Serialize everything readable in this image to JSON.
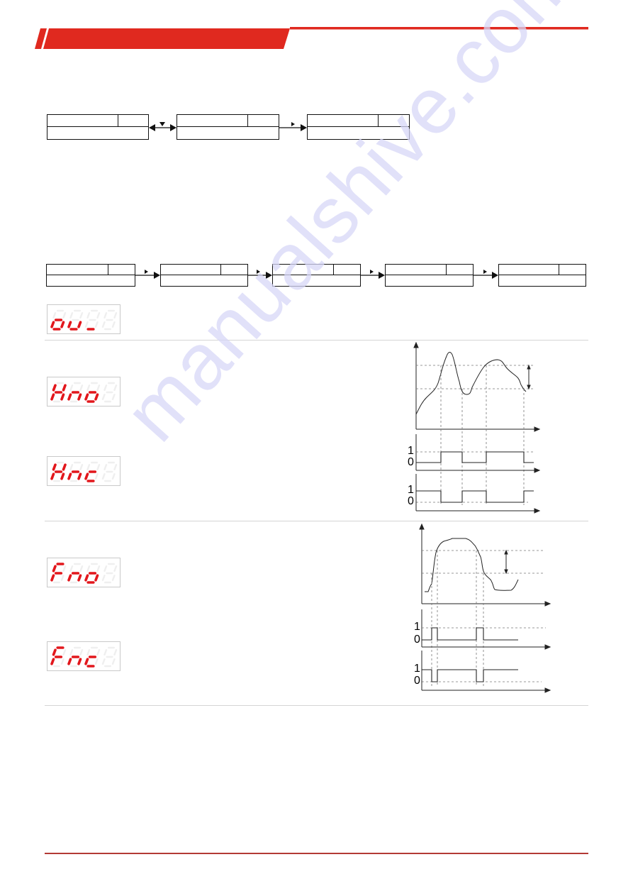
{
  "header": {
    "accent_color": "#e0291f"
  },
  "flow_row_1": {
    "boxes": [
      {
        "label": "",
        "value": "",
        "sub": ""
      },
      {
        "label": "",
        "value": "",
        "sub": ""
      },
      {
        "label": "",
        "value": "",
        "sub": ""
      }
    ],
    "connectors": [
      "bidirectional-down-arrow",
      "right-arrow"
    ]
  },
  "flow_row_2": {
    "boxes": [
      {
        "label": "",
        "value": "",
        "sub": ""
      },
      {
        "label": "",
        "value": "",
        "sub": ""
      },
      {
        "label": "",
        "value": "",
        "sub": ""
      },
      {
        "label": "",
        "value": "",
        "sub": ""
      },
      {
        "label": "",
        "value": "",
        "sub": ""
      }
    ],
    "connectors": [
      "right-arrow",
      "right-arrow",
      "right-arrow",
      "right-arrow"
    ]
  },
  "displays": [
    {
      "id": "ou",
      "text": "ou_",
      "color": "#e2171c"
    },
    {
      "id": "hno",
      "text": "Hno",
      "color": "#e2171c"
    },
    {
      "id": "hnc",
      "text": "Hnc",
      "color": "#e2171c"
    },
    {
      "id": "fno",
      "text": "Fno",
      "color": "#e2171c"
    },
    {
      "id": "fnc",
      "text": "Fnc",
      "color": "#e2171c"
    }
  ],
  "timing_labels": {
    "one": "1",
    "zero": "0"
  },
  "watermark": "manualshive.com"
}
